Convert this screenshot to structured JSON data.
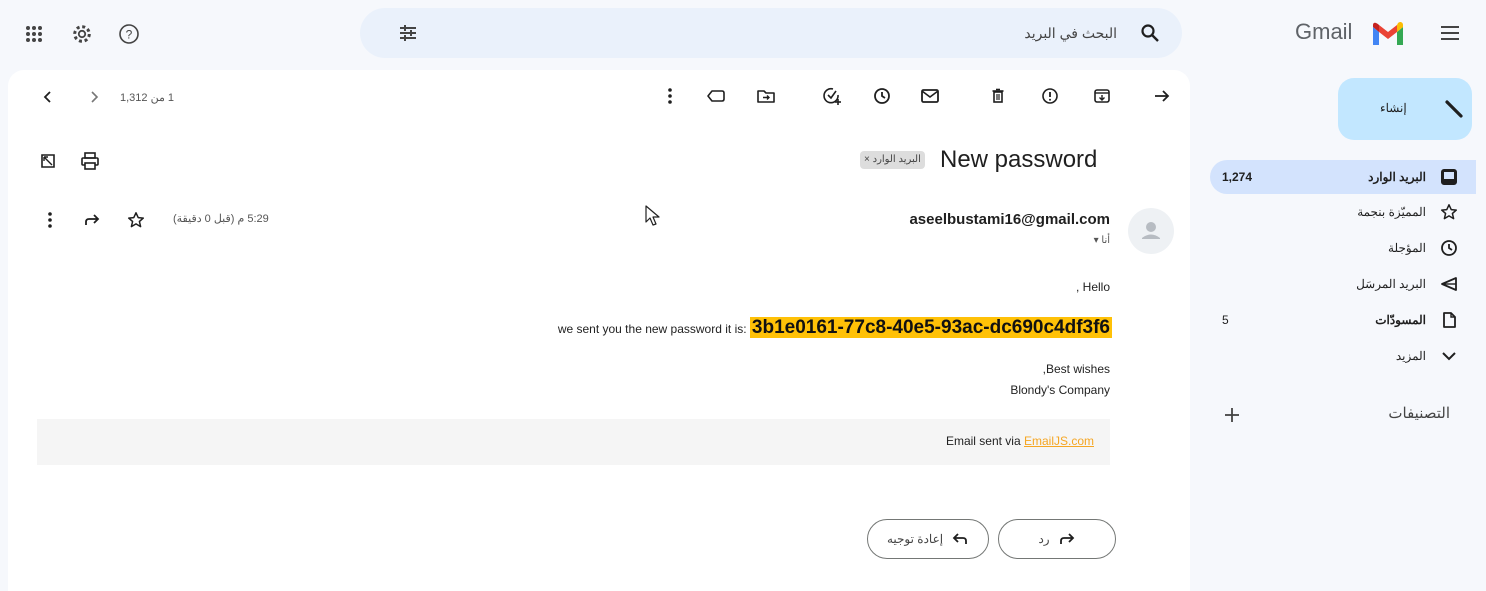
{
  "topbar": {
    "search_placeholder": "البحث في البريد",
    "brand": "Gmail"
  },
  "sidebar": {
    "compose_label": "إنشاء",
    "items": [
      {
        "label": "البريد الوارد",
        "count": "1,274",
        "icon": "inbox-icon",
        "selected": true,
        "bold": true
      },
      {
        "label": "المميّزة بنجمة",
        "count": "",
        "icon": "star-icon"
      },
      {
        "label": "المؤجلة",
        "count": "",
        "icon": "clock-icon"
      },
      {
        "label": "البريد المرسَل",
        "count": "",
        "icon": "send-icon"
      },
      {
        "label": "المسودّات",
        "count": "5",
        "icon": "draft-icon",
        "bold": true
      },
      {
        "label": "المزيد",
        "count": "",
        "icon": "chevron-down-icon"
      }
    ],
    "labels_heading": "التصنيفات"
  },
  "toolbar": {
    "pager": "1 من 1,312"
  },
  "email": {
    "subject": "New password",
    "chip": "البريد الوارد ×",
    "sender": "aseelbustami16@gmail.com",
    "to": "أنا ▾",
    "time": "5:29 م (قبل 0 دقيقة)",
    "greeting": ", Hello",
    "password_intro": "we sent you the new password it is: ",
    "password_value": "3b1e0161-77c8-40e5-93ac-dc690c4df3f6",
    "closing": ",Best wishes",
    "company": "Blondy's Company",
    "footer_prefix": "Email sent via ",
    "footer_link": "EmailJS.com"
  },
  "actions": {
    "reply": "رد",
    "forward": "إعادة توجيه"
  },
  "colors": {
    "background": "#f6f8fc",
    "compose": "#c2e7ff",
    "selected_nav": "#d3e3fd",
    "highlight": "#ffc107",
    "link": "#f5a623"
  }
}
